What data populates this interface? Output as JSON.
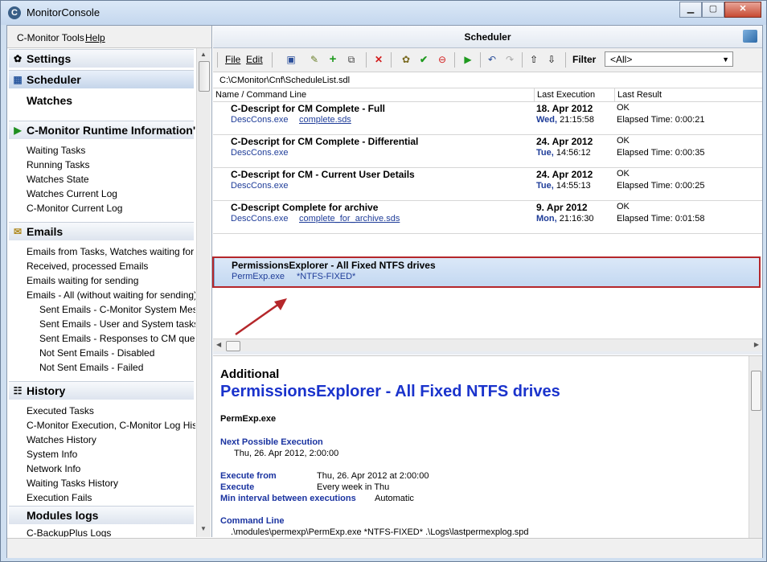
{
  "window": {
    "title": "MonitorConsole",
    "app_icon": "C"
  },
  "left_menu": [
    "C-Monitor Tools",
    "Help"
  ],
  "nav": {
    "settings": "Settings",
    "scheduler": "Scheduler",
    "watches": "Watches",
    "runtime": {
      "title": "C-Monitor Runtime Information'",
      "items": [
        "Waiting Tasks",
        "Running Tasks",
        "Watches State",
        "Watches Current Log",
        "C-Monitor Current Log"
      ]
    },
    "emails": {
      "title": "Emails",
      "items": [
        "Emails from Tasks, Watches waiting for sending",
        "Received, processed Emails",
        "Emails waiting for sending",
        "Emails - All (without waiting for sending)"
      ],
      "sub_items": [
        "Sent Emails - C-Monitor System Messages",
        "Sent Emails - User and System tasks Results",
        "Sent Emails - Responses to CM queries",
        "Not Sent Emails - Disabled",
        "Not Sent Emails - Failed"
      ]
    },
    "history": {
      "title": "History",
      "items": [
        "Executed Tasks",
        "C-Monitor Execution, C-Monitor Log History",
        "Watches History",
        "System Info",
        "Network Info",
        "Waiting Tasks History",
        "Execution Fails"
      ]
    },
    "modules": {
      "title": "Modules logs",
      "items": [
        "C-BackupPlus Logs"
      ]
    }
  },
  "scheduler": {
    "title": "Scheduler",
    "toolbar": {
      "file": "File",
      "edit": "Edit",
      "filter_label": "Filter",
      "filter_value": "<All>"
    },
    "path": "C:\\CMonitor\\Cnf\\ScheduleList.sdl",
    "columns": [
      "Name / Command Line",
      "Last Execution",
      "Last Result"
    ],
    "rows": [
      {
        "name": "C-Descript for CM Complete - Full",
        "exe": "DescCons.exe",
        "file": "complete.sds",
        "date": "18. Apr 2012",
        "day": "Wed,",
        "time": "21:15:58",
        "result": "OK",
        "elapsed": "Elapsed Time: 0:00:21"
      },
      {
        "name": "C-Descript for CM Complete - Differential",
        "exe": "DescCons.exe",
        "file": "",
        "date": "24. Apr 2012",
        "day": "Tue,",
        "time": "14:56:12",
        "result": "OK",
        "elapsed": "Elapsed Time: 0:00:35"
      },
      {
        "name": "C-Descript for CM - Current User Details",
        "exe": "DescCons.exe",
        "file": "",
        "date": "24. Apr 2012",
        "day": "Tue,",
        "time": "14:55:13",
        "result": "OK",
        "elapsed": "Elapsed Time: 0:00:25"
      },
      {
        "name": "C-Descript Complete for archive",
        "exe": "DescCons.exe",
        "file": "complete_for_archive.sds",
        "date": "9. Apr 2012",
        "day": "Mon,",
        "time": "21:16:30",
        "result": "OK",
        "elapsed": "Elapsed Time: 0:01:58"
      }
    ],
    "selected_row": {
      "name": "PermissionsExplorer - All Fixed NTFS drives",
      "exe": "PermExp.exe",
      "params": "*NTFS-FIXED*"
    }
  },
  "detail": {
    "additional": "Additional",
    "title": "PermissionsExplorer - All Fixed NTFS drives",
    "exe": "PermExp.exe",
    "next_label": "Next Possible Execution",
    "next_value": "Thu, 26. Apr 2012, 2:00:00",
    "exec_from_label": "Execute from",
    "exec_from_value": "Thu, 26. Apr 2012 at 2:00:00",
    "execute_label": "Execute",
    "execute_value": "Every week in Thu",
    "min_label": "Min interval between executions",
    "min_value": "Automatic",
    "cmd_label": "Command Line",
    "cmd_value": ".\\modules\\permexp\\PermExp.exe *NTFS-FIXED* .\\Logs\\lastpermexplog.spd"
  },
  "colors": {
    "accent_blue": "#1a33cc",
    "highlight_red": "#b5272b",
    "selection": "#c3d8f1"
  }
}
